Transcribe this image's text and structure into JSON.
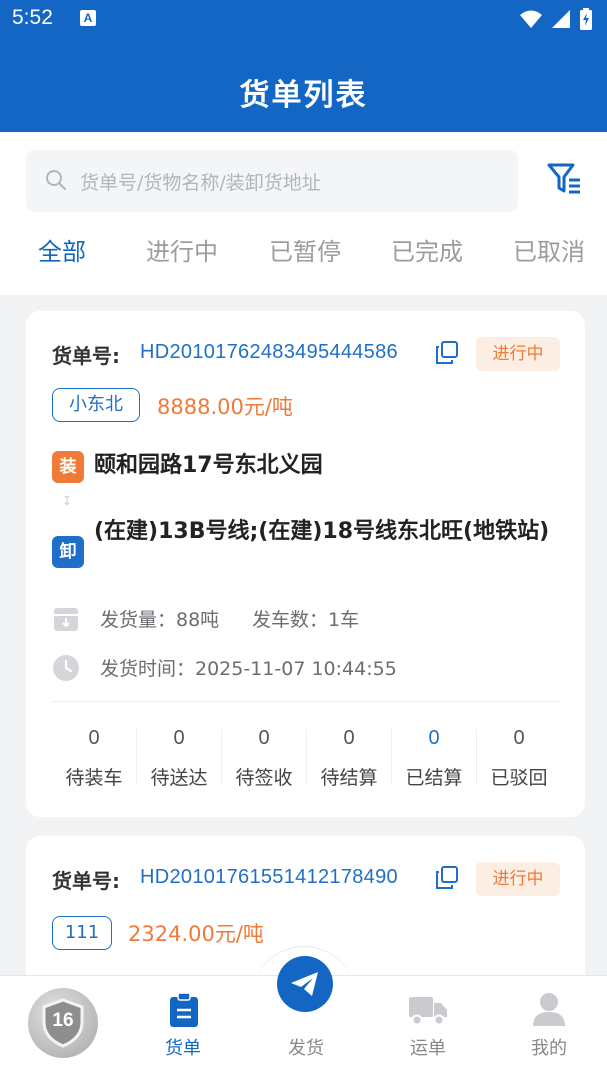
{
  "status_bar": {
    "time": "5:52",
    "notif_icon": "A"
  },
  "header": {
    "title": "货单列表"
  },
  "search": {
    "placeholder": "货单号/货物名称/装卸货地址"
  },
  "tabs": [
    {
      "label": "全部",
      "active": true
    },
    {
      "label": "进行中",
      "active": false
    },
    {
      "label": "已暂停",
      "active": false
    },
    {
      "label": "已完成",
      "active": false
    },
    {
      "label": "已取消",
      "active": false
    }
  ],
  "orders": [
    {
      "order_label": "货单号:",
      "order_no": "HD20101762483495444586",
      "status": "进行中",
      "customer_tag": "小东北",
      "price": "8888.00元/吨",
      "load_badge": "装",
      "load_address": "颐和园路17号东北义园",
      "unload_badge": "卸",
      "unload_address": "(在建)13B号线;(在建)18号线东北旺(地铁站)",
      "volume_text": "发货量：88吨",
      "trucks_text": "发车数：1车",
      "time_text": "发货时间：2025-11-07 10:44:55",
      "stats": [
        {
          "value": "0",
          "label": "待装车",
          "highlight": false
        },
        {
          "value": "0",
          "label": "待送达",
          "highlight": false
        },
        {
          "value": "0",
          "label": "待签收",
          "highlight": false
        },
        {
          "value": "0",
          "label": "待结算",
          "highlight": false
        },
        {
          "value": "0",
          "label": "已结算",
          "highlight": true
        },
        {
          "value": "0",
          "label": "已驳回",
          "highlight": false
        }
      ]
    },
    {
      "order_label": "货单号:",
      "order_no": "HD20101761551412178490",
      "status": "进行中",
      "customer_tag": "111",
      "price": "2324.00元/吨"
    }
  ],
  "bottom_nav": {
    "badge_level": "16",
    "items": [
      {
        "label": "货单",
        "active": true,
        "icon": "clipboard-icon"
      },
      {
        "label": "发货",
        "active": false,
        "icon": "send-icon"
      },
      {
        "label": "运单",
        "active": false,
        "icon": "truck-icon"
      },
      {
        "label": "我的",
        "active": false,
        "icon": "user-icon"
      }
    ]
  },
  "colors": {
    "primary": "#1466c4",
    "accent": "#f07a38",
    "link": "#1f6fc8"
  }
}
